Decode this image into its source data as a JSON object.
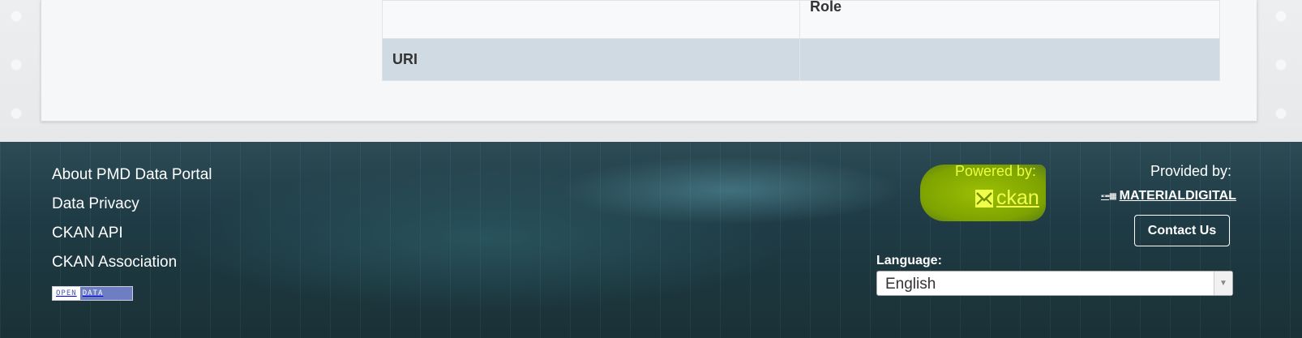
{
  "table": {
    "role_label": "Role",
    "uri_label": "URI",
    "uri_value": ""
  },
  "footer": {
    "links": [
      "About PMD Data Portal",
      "Data Privacy",
      "CKAN API",
      "CKAN Association"
    ],
    "open_data_badge": {
      "left": "OPEN",
      "right": "DATA"
    },
    "powered_by_label": "Powered by:",
    "ckan_logo_text": "ckan",
    "provided_by_label": "Provided by:",
    "materialdigital_logo_text": "MATERIALDIGITAL",
    "contact_button": "Contact Us",
    "language_label": "Language:",
    "language_selected": "English",
    "colors": {
      "highlight": "#7ea300",
      "ckan_text": "#f1ff4a",
      "footer_bg": "#1f3b45",
      "uri_row": "#d0dae2"
    }
  }
}
